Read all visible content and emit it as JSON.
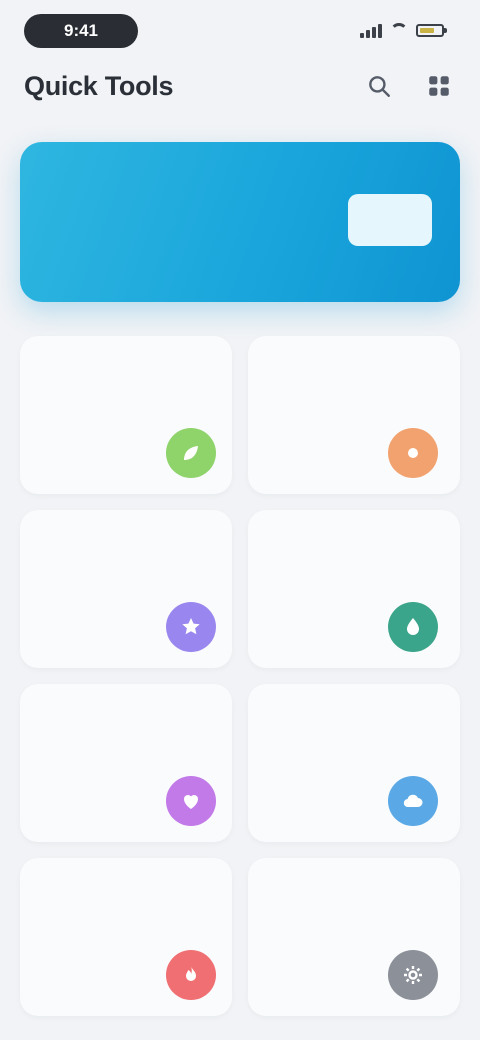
{
  "status_bar": {
    "time": "9:41"
  },
  "header": {
    "title": "Quick Tools"
  },
  "banner": {
    "title": "",
    "subtitle": "",
    "badge": ""
  },
  "tiles": [
    {
      "name": "green",
      "title": "",
      "subtitle": "",
      "color": "#8fd36b",
      "icon": "leaf-icon"
    },
    {
      "name": "orange",
      "title": "",
      "subtitle": "",
      "color": "#f2a26f",
      "icon": "sun-icon"
    },
    {
      "name": "purple",
      "title": "",
      "subtitle": "",
      "color": "#9a86ef",
      "icon": "star-icon"
    },
    {
      "name": "teal",
      "title": "",
      "subtitle": "",
      "color": "#3aa58a",
      "icon": "drop-icon"
    },
    {
      "name": "violet",
      "title": "",
      "subtitle": "",
      "color": "#c27ae8",
      "icon": "heart-icon"
    },
    {
      "name": "blue",
      "title": "",
      "subtitle": "",
      "color": "#5aa9e6",
      "icon": "cloud-icon"
    },
    {
      "name": "red",
      "title": "",
      "subtitle": "",
      "color": "#ef6f72",
      "icon": "flame-icon"
    },
    {
      "name": "gray",
      "title": "",
      "subtitle": "",
      "color": "#8c9099",
      "icon": "gear-icon"
    }
  ],
  "colors": {
    "background": "#f1f3f6",
    "banner": "#1aa6dc"
  }
}
